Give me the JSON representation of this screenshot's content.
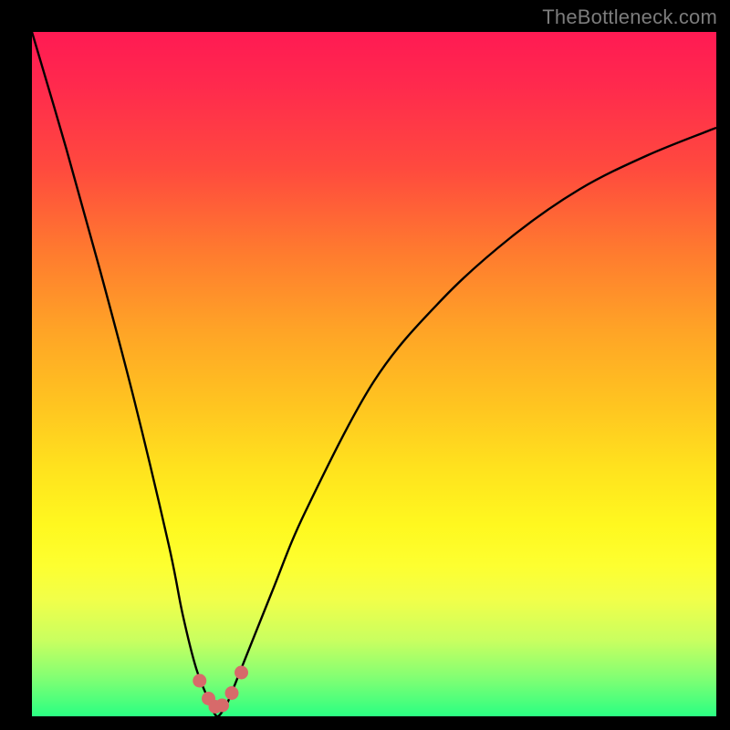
{
  "watermark": "TheBottleneck.com",
  "colors": {
    "frame": "#000000",
    "curve": "#000000",
    "dots": "#d76a6a",
    "bottom_band": "#2bff82"
  },
  "chart_data": {
    "type": "line",
    "title": "",
    "xlabel": "",
    "ylabel": "",
    "xlim": [
      0,
      100
    ],
    "ylim": [
      0,
      100
    ],
    "series": [
      {
        "name": "bottleneck-curve",
        "x": [
          0,
          5,
          10,
          15,
          20,
          22,
          24,
          26,
          27,
          28,
          29,
          35,
          40,
          50,
          60,
          70,
          80,
          90,
          100
        ],
        "y": [
          100,
          83,
          65,
          46,
          25,
          15,
          7,
          2,
          0,
          1,
          3,
          18,
          30,
          49,
          61,
          70,
          77,
          82,
          86
        ]
      }
    ],
    "minimum_x": 27,
    "annotations": {
      "dots": [
        {
          "x": 24.5,
          "y": 5.2
        },
        {
          "x": 25.8,
          "y": 2.6
        },
        {
          "x": 26.8,
          "y": 1.4
        },
        {
          "x": 27.8,
          "y": 1.6
        },
        {
          "x": 29.2,
          "y": 3.4
        },
        {
          "x": 30.6,
          "y": 6.4
        }
      ]
    }
  }
}
